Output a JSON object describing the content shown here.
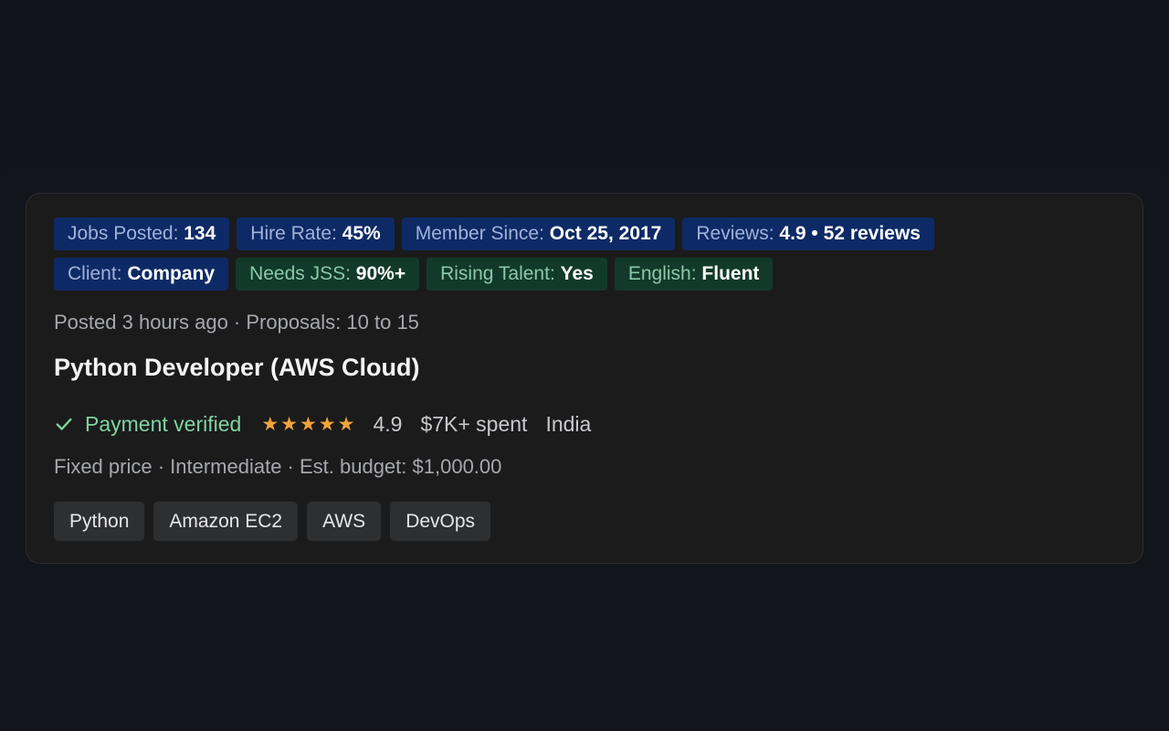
{
  "badges_row1": [
    {
      "label": "Jobs Posted:",
      "value": "134"
    },
    {
      "label": "Hire Rate:",
      "value": "45%"
    },
    {
      "label": "Member Since:",
      "value": "Oct 25, 2017"
    },
    {
      "label": "Reviews:",
      "value": "4.9 • 52 reviews"
    }
  ],
  "badges_row2": [
    {
      "label": "Client:",
      "value": "Company"
    },
    {
      "label": "Needs JSS:",
      "value": "90%+"
    },
    {
      "label": "Rising Talent:",
      "value": "Yes"
    },
    {
      "label": "English:",
      "value": "Fluent"
    }
  ],
  "job": {
    "meta": "Posted 3 hours ago · Proposals: 10 to 15",
    "title": "Python Developer (AWS Cloud)",
    "payment": "Payment verified",
    "stars": "★★★★★",
    "rating": "4.9",
    "spent": "$7K+ spent",
    "country": "India",
    "details": "Fixed price · Intermediate · Est. budget: $1,000.00",
    "tags": [
      "Python",
      "Amazon EC2",
      "AWS",
      "DevOps"
    ]
  },
  "colors": {
    "badge_blue": "#0e2a66",
    "badge_green": "#123a2b",
    "payment_green": "#7fd4a0",
    "star_orange": "#f2a33a"
  }
}
